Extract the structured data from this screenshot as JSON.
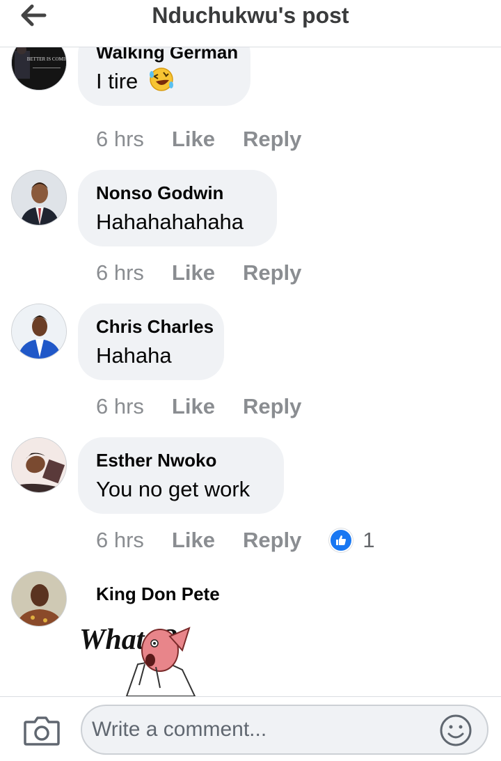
{
  "header": {
    "title": "Nduchukwu's post",
    "back_icon": "arrow-left-icon"
  },
  "comments": [
    {
      "author": "Walking German",
      "text": "I tire",
      "emoji": "rolling-on-floor-laughing-icon",
      "avatar_text": "BETTER IS COMING",
      "time": "6 hrs",
      "like": "Like",
      "reply": "Reply"
    },
    {
      "author": "Nonso Godwin",
      "text": "Hahahahahaha",
      "time": "6 hrs",
      "like": "Like",
      "reply": "Reply"
    },
    {
      "author": "Chris Charles",
      "text": "Hahaha",
      "time": "6 hrs",
      "like": "Like",
      "reply": "Reply"
    },
    {
      "author": "Esther Nwoko",
      "text": "You no get work",
      "time": "6 hrs",
      "like": "Like",
      "reply": "Reply",
      "reaction_icon": "thumbs-up-icon",
      "reaction_count": "1"
    },
    {
      "author": "King Don Pete",
      "sticker_text": "What !?"
    }
  ],
  "composer": {
    "placeholder": "Write a comment...",
    "camera_icon": "camera-icon",
    "emoji_icon": "smiley-icon"
  },
  "colors": {
    "bubble": "#f0f2f5",
    "meta_text": "#8a8d91",
    "like_blue": "#1877f2"
  }
}
